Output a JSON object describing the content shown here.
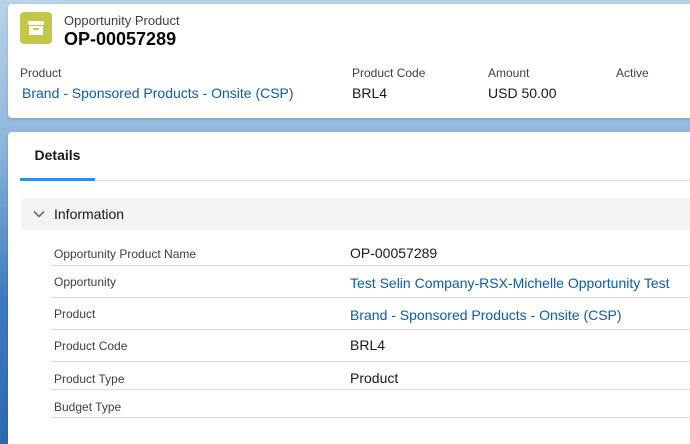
{
  "header": {
    "object_type": "Opportunity Product",
    "record_title": "OP-00057289",
    "icon": "archive-box-icon",
    "icon_color": "#c5c548",
    "fields": [
      {
        "label": "Product",
        "value": "Brand - Sponsored Products - Onsite (CSP)",
        "link": true
      },
      {
        "label": "Product Code",
        "value": "BRL4",
        "link": false
      },
      {
        "label": "Amount",
        "value": "USD 50.00",
        "link": false
      },
      {
        "label": "Active",
        "value": "",
        "link": false
      }
    ]
  },
  "tabs": [
    {
      "label": "Details",
      "active": true
    }
  ],
  "section": {
    "title": "Information",
    "expanded": true,
    "icon": "chevron-down-icon",
    "rows": [
      {
        "label": "Opportunity Product Name",
        "value": "OP-00057289",
        "link": false
      },
      {
        "label": "Opportunity",
        "value": "Test Selin Company-RSX-Michelle Opportunity Test",
        "link": true
      },
      {
        "label": "Product",
        "value": "Brand - Sponsored Products - Onsite (CSP)",
        "link": true
      },
      {
        "label": "Product Code",
        "value": "BRL4",
        "link": false
      },
      {
        "label": "Product Type",
        "value": "Product",
        "link": false
      },
      {
        "label": "Budget Type",
        "value": "",
        "link": false
      }
    ]
  },
  "colors": {
    "link": "#0b5cab",
    "tab_accent": "#1b96ff"
  }
}
